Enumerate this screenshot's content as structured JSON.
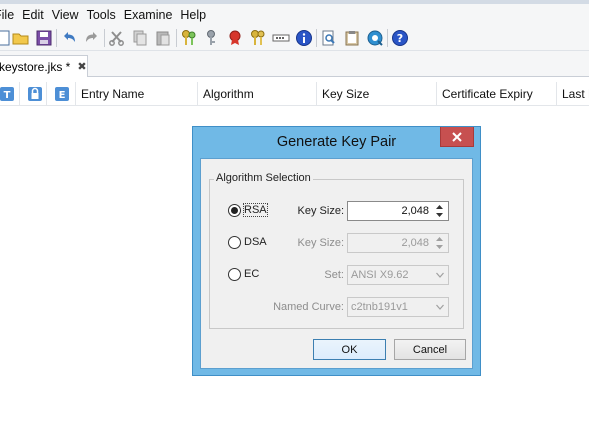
{
  "menu": [
    "File",
    "Edit",
    "View",
    "Tools",
    "Examine",
    "Help"
  ],
  "toolbar": {
    "icons": [
      "new-keystore-icon",
      "open-keystore-icon",
      "save-keystore-icon",
      "undo-icon",
      "redo-icon",
      "cut-icon",
      "copy-icon",
      "paste-icon",
      "generate-key-pair-icon",
      "generate-secret-key-icon",
      "import-trusted-cert-icon",
      "import-key-pair-icon",
      "set-password-icon",
      "properties-icon",
      "examine-file-icon",
      "examine-clipboard-icon",
      "examine-ssl-icon",
      "help-icon"
    ]
  },
  "tab": {
    "label": "keystore.jks *",
    "close": "✖"
  },
  "table": {
    "columns": [
      "Entry Name",
      "Algorithm",
      "Key Size",
      "Certificate Expiry",
      "Last M"
    ],
    "icon_columns": [
      "T",
      "lock",
      "E"
    ]
  },
  "dialog": {
    "title": "Generate Key Pair",
    "group_label": "Algorithm Selection",
    "rsa": {
      "label": "RSA",
      "selected": true,
      "key_size_label": "Key Size:",
      "key_size": "2,048"
    },
    "dsa": {
      "label": "DSA",
      "selected": false,
      "key_size_label": "Key Size:",
      "key_size": "2,048"
    },
    "ec": {
      "label": "EC",
      "selected": false,
      "set_label": "Set:",
      "set_value": "ANSI X9.62",
      "curve_label": "Named Curve:",
      "curve_value": "c2tnb191v1"
    },
    "ok_label": "OK",
    "cancel_label": "Cancel"
  },
  "colors": {
    "dialog_frame": "#70b9e6",
    "close_button": "#c75050",
    "accent": "#3c7fb1"
  }
}
